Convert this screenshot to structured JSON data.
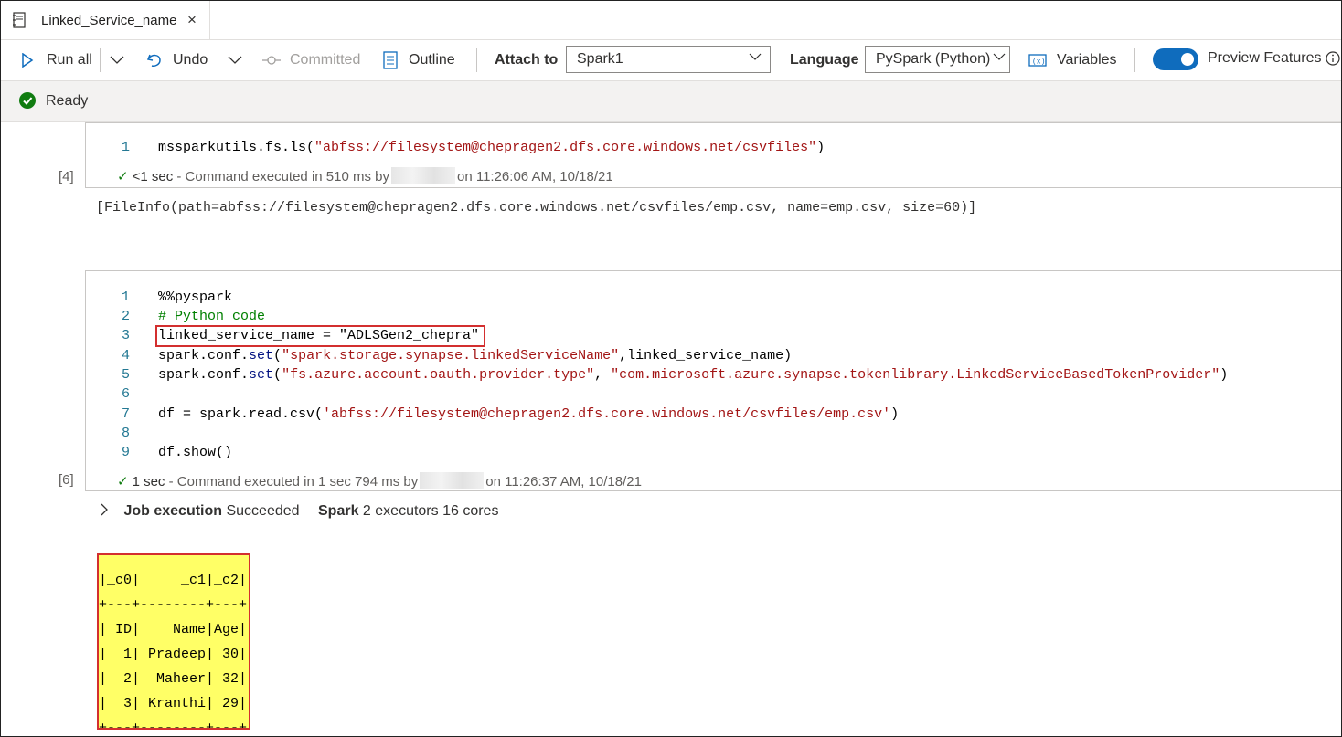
{
  "tab": {
    "title": "Linked_Service_name",
    "close": "×"
  },
  "toolbar": {
    "run_all": "Run all",
    "undo": "Undo",
    "committed": "Committed",
    "outline": "Outline",
    "attach_to_label": "Attach to",
    "attach_to_value": "Spark1",
    "language_label": "Language",
    "language_value": "PySpark (Python)",
    "variables": "Variables",
    "preview_features": "Preview Features",
    "preview_features_on": true
  },
  "status": {
    "text": "Ready"
  },
  "cell1": {
    "index": "[4]",
    "lines": [
      {
        "n": "1",
        "text": "mssparkutils.fs.ls(\"abfss://filesystem@chepragen2.dfs.core.windows.net/csvfiles\")"
      }
    ],
    "exec_duration": "<1 sec",
    "exec_text": "- Command executed in 510 ms by",
    "exec_time": "on 11:26:06 AM, 10/18/21",
    "output": "[FileInfo(path=abfss://filesystem@chepragen2.dfs.core.windows.net/csvfiles/emp.csv, name=emp.csv, size=60)]"
  },
  "cell2": {
    "index": "[6]",
    "line_numbers": [
      "1",
      "2",
      "3",
      "4",
      "5",
      "6",
      "7",
      "8",
      "9"
    ],
    "l1": "%%pyspark",
    "l2": "# Python code",
    "l3": "linked_service_name = \"ADLSGen2_chepra\"",
    "l4a": "spark.conf.",
    "l4b": "set",
    "l4c": "(",
    "l4d": "\"spark.storage.synapse.linkedServiceName\"",
    "l4e": ",linked_service_name)",
    "l5a": "spark.conf.",
    "l5b": "set",
    "l5c": "(",
    "l5d": "\"fs.azure.account.oauth.provider.type\"",
    "l5e": ", ",
    "l5f": "\"com.microsoft.azure.synapse.tokenlibrary.LinkedServiceBasedTokenProvider\"",
    "l5g": ")",
    "l7a": "df = spark.read.csv(",
    "l7b": "'abfss://filesystem@chepragen2.dfs.core.windows.net/csvfiles/emp.csv'",
    "l7c": ")",
    "l9": "df.show()",
    "exec_duration": "1 sec",
    "exec_text": "- Command executed in 1 sec 794 ms by",
    "exec_time": "on 11:26:37 AM, 10/18/21"
  },
  "job": {
    "label": "Job execution",
    "state": "Succeeded",
    "spark_label": "Spark",
    "spark_info": "2 executors 16 cores"
  },
  "table_output": [
    "+---+--------+---+",
    "|_c0|     _c1|_c2|",
    "+---+--------+---+",
    "| ID|    Name|Age|",
    "|  1| Pradeep| 30|",
    "|  2|  Maheer| 32|",
    "|  3| Kranthi| 29|",
    "+---+--------+---+"
  ]
}
